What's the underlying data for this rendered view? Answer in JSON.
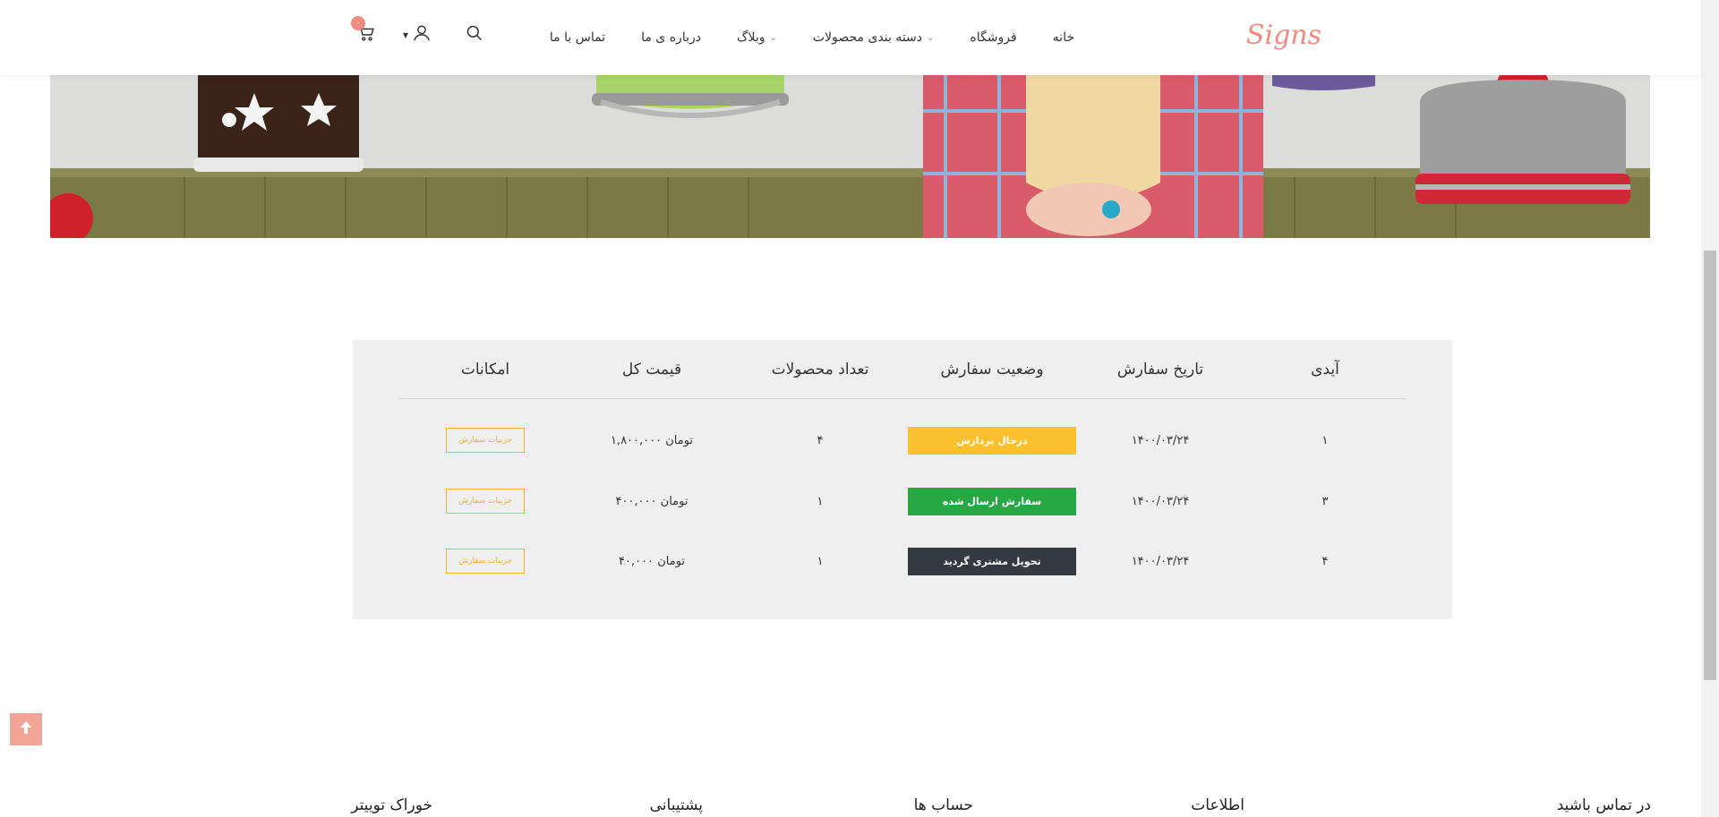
{
  "header": {
    "logo": "Signs",
    "nav": [
      {
        "label": "خانه",
        "has_dropdown": false
      },
      {
        "label": "فروشگاه",
        "has_dropdown": false
      },
      {
        "label": "دسته بندی محصولات",
        "has_dropdown": true
      },
      {
        "label": "وبلاگ",
        "has_dropdown": true
      },
      {
        "label": "درباره ی ما",
        "has_dropdown": false
      },
      {
        "label": "تماس با ما",
        "has_dropdown": false
      }
    ],
    "cart_count": "۰",
    "icons": [
      "search-icon",
      "user-icon",
      "cart-icon"
    ]
  },
  "orders": {
    "headers": {
      "id": "آیدی",
      "date": "تاریخ سفارش",
      "status": "وضعیت سفارش",
      "count": "تعداد محصولات",
      "price": "قیمت کل",
      "actions": "امکانات"
    },
    "rows": [
      {
        "id": "۱",
        "date": "۱۴۰۰/۰۳/۲۴",
        "status": "درحال پردازش",
        "status_color": "#fbc02d",
        "count": "۴",
        "price": "۱,۸۰۰,۰۰۰ تومان",
        "action": "جزییات سفارش"
      },
      {
        "id": "۳",
        "date": "۱۴۰۰/۰۳/۲۴",
        "status": "سفارش ارسال شده",
        "status_color": "#28a745",
        "count": "۱",
        "price": "۴۰۰,۰۰۰ تومان",
        "action": "جزییات سفارش"
      },
      {
        "id": "۴",
        "date": "۱۴۰۰/۰۳/۲۴",
        "status": "تحویل مشتری گردید",
        "status_color": "#343a40",
        "count": "۱",
        "price": "۴۰,۰۰۰ تومان",
        "action": "جزییات سفارش"
      }
    ]
  },
  "footer": {
    "headings": [
      "در تماس باشید",
      "اطلاعات",
      "حساب ها",
      "پشتیبانی",
      "خوراک توییتر"
    ]
  },
  "colors": {
    "accent": "#f08a7e",
    "back_to_top": "#f2a497",
    "details_button": "#f0b429"
  }
}
